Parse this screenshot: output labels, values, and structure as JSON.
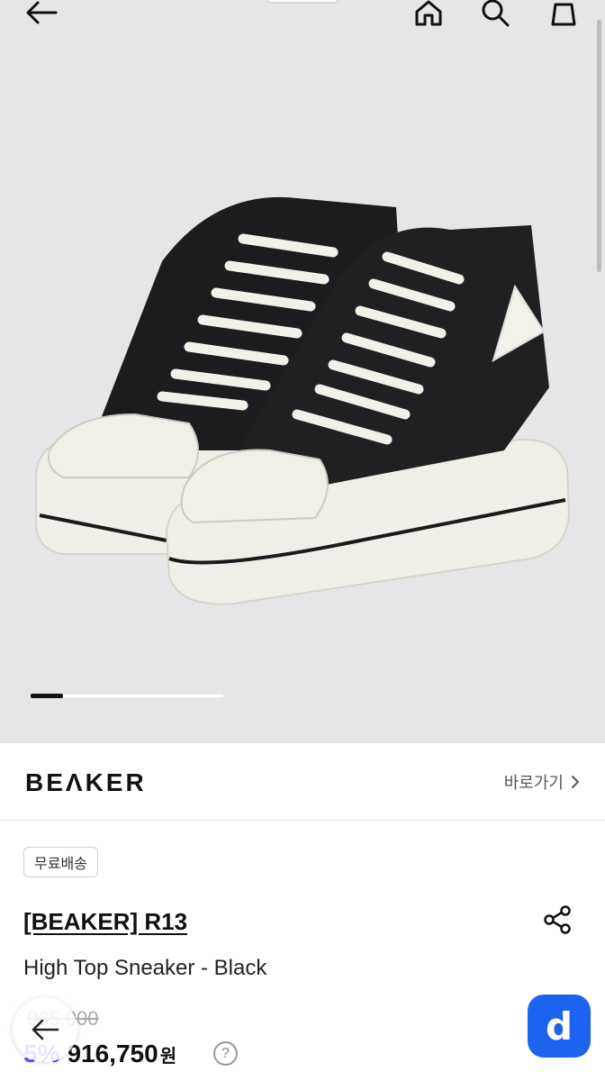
{
  "brand": {
    "logo_text": "BEΛKER",
    "goto_label": "바로가기"
  },
  "product": {
    "shipping_badge": "무료배송",
    "brand_title": "[BEAKER] R13",
    "name": "High Top Sneaker - Black",
    "original_price": "965,000",
    "discount_rate": "5%",
    "sale_price": "916,750",
    "currency": "원"
  },
  "gallery": {
    "current_slide_fraction": 0.17
  },
  "floating": {
    "app_badge_letter": "d"
  },
  "icons": {
    "back": "arrow-left-icon",
    "home": "home-icon",
    "search": "search-icon",
    "cart": "shopping-bag-icon",
    "share": "share-icon",
    "help": "question-circle-icon",
    "chevron": "chevron-right-icon"
  },
  "colors": {
    "accent": "#6c4dfc",
    "app_badge": "#1e63f0",
    "hero_background": "#e6e6e8"
  }
}
